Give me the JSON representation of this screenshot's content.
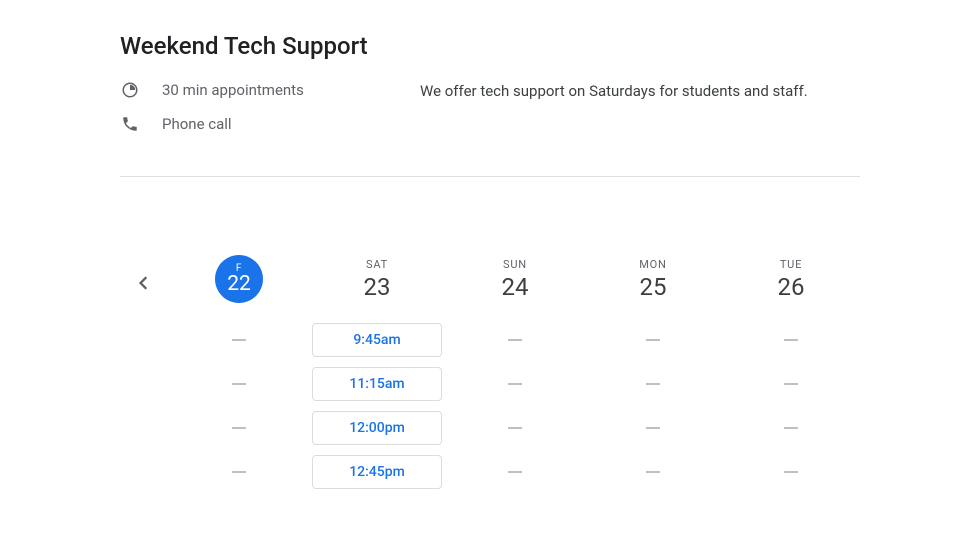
{
  "title": "Weekend Tech Support",
  "info": {
    "duration": "30 min appointments",
    "method": "Phone call"
  },
  "description": "We offer tech support on Saturdays for students and staff.",
  "days": [
    {
      "dow": "F",
      "num": "22",
      "selected": true,
      "slots": []
    },
    {
      "dow": "SAT",
      "num": "23",
      "selected": false,
      "slots": [
        "9:45am",
        "11:15am",
        "12:00pm",
        "12:45pm"
      ]
    },
    {
      "dow": "SUN",
      "num": "24",
      "selected": false,
      "slots": []
    },
    {
      "dow": "MON",
      "num": "25",
      "selected": false,
      "slots": []
    },
    {
      "dow": "TUE",
      "num": "26",
      "selected": false,
      "slots": []
    }
  ],
  "rows": 4
}
